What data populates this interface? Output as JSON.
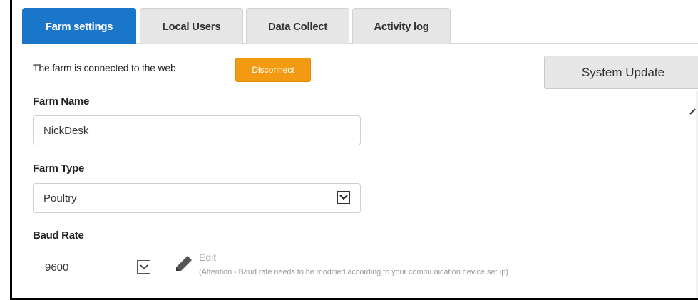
{
  "tabs": [
    {
      "label": "Farm settings",
      "active": true
    },
    {
      "label": "Local Users",
      "active": false
    },
    {
      "label": "Data Collect",
      "active": false
    },
    {
      "label": "Activity log",
      "active": false
    }
  ],
  "connection": {
    "status_text": "The farm is connected to the web",
    "disconnect_label": "Disconnect"
  },
  "system_update_label": "System Update",
  "farm_name": {
    "label": "Farm Name",
    "value": "NickDesk"
  },
  "farm_type": {
    "label": "Farm Type",
    "value": "Poultry"
  },
  "baud_rate": {
    "label": "Baud Rate",
    "value": "9600",
    "edit_label": "Edit",
    "note": "(Attention - Baud rate needs to be modified according to your communication device setup)"
  },
  "colors": {
    "active_tab": "#1a76c8",
    "disconnect_button": "#f29b12",
    "inactive_tab": "#e6e6e6"
  },
  "icons": [
    "chevron-down-icon",
    "pencil-icon"
  ]
}
